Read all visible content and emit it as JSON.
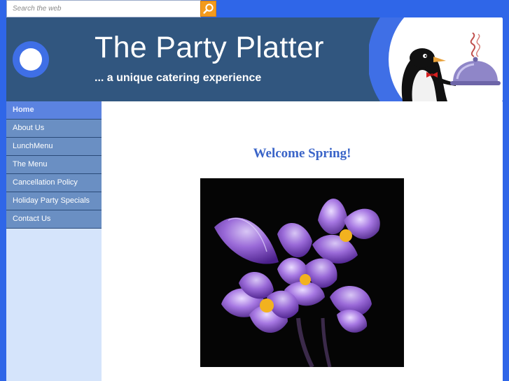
{
  "search": {
    "placeholder": "Search the web",
    "button_icon": "magnifier-icon"
  },
  "header": {
    "title": "The Party Platter",
    "tagline": "... a unique catering experience",
    "mascot": "penguin-waiter-with-cloche"
  },
  "sidebar": {
    "items": [
      {
        "label": "Home",
        "active": true
      },
      {
        "label": "About Us",
        "active": false
      },
      {
        "label": "LunchMenu",
        "active": false
      },
      {
        "label": "The Menu",
        "active": false
      },
      {
        "label": "Cancellation Policy",
        "active": false
      },
      {
        "label": "Holiday Party Specials",
        "active": false
      },
      {
        "label": "Contact Us",
        "active": false
      }
    ]
  },
  "main": {
    "heading": "Welcome Spring!",
    "image_subject": "purple crocus flowers"
  },
  "colors": {
    "page_background": "#2f66e8",
    "header_background": "#31567f",
    "nav_item": "#6a8fc3",
    "nav_active": "#5b83e0",
    "sidebar_background": "#d5e4fb",
    "heading_text": "#3a64c8",
    "search_button": "#f39a1d"
  }
}
